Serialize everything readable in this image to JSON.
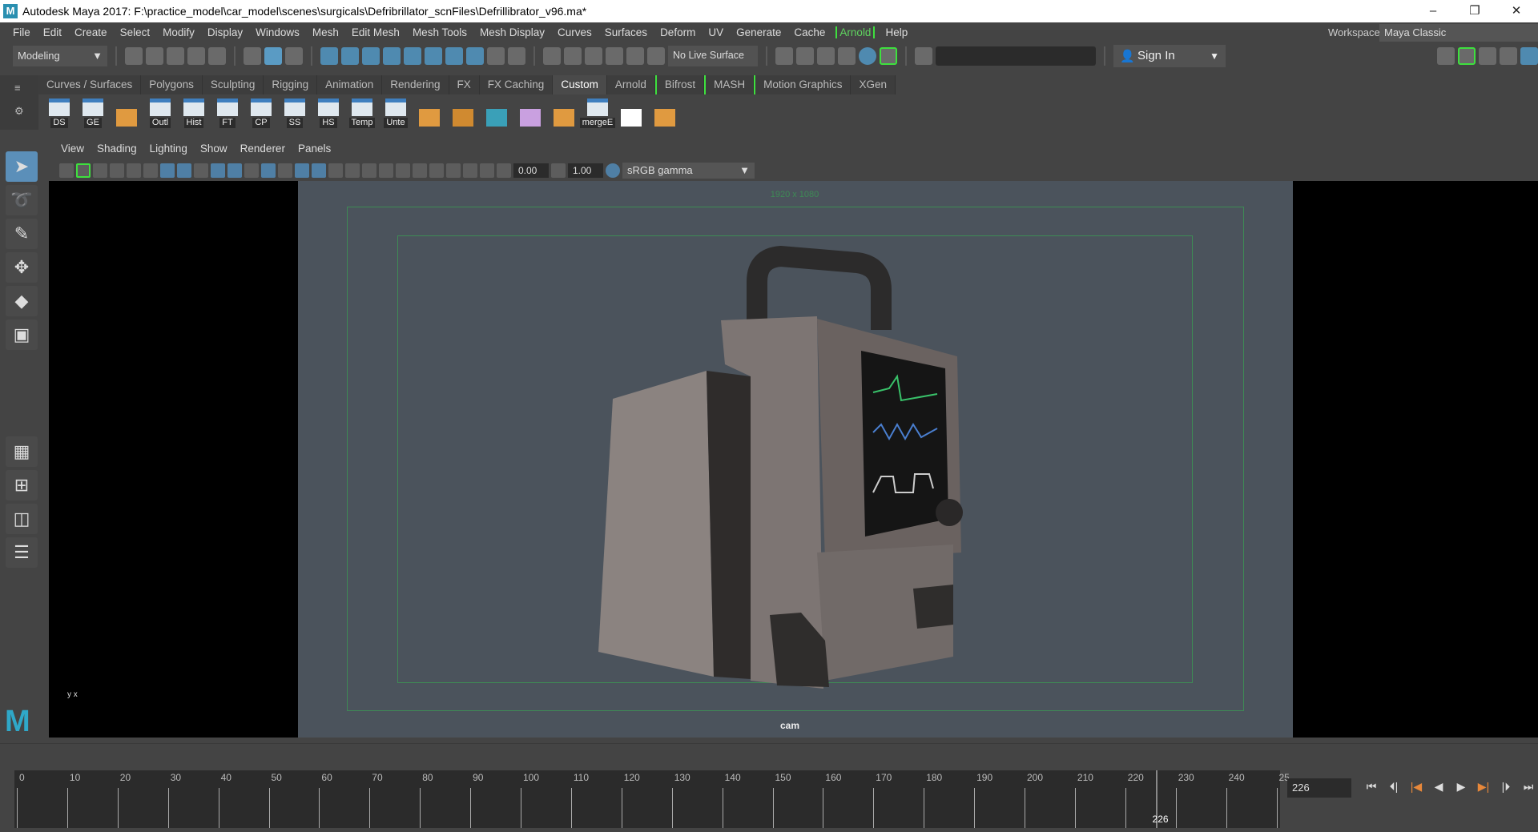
{
  "window": {
    "title": "Autodesk Maya 2017: F:\\practice_model\\car_model\\scenes\\surgicals\\Defribrillator_scnFiles\\Defrillibrator_v96.ma*",
    "logo": "M",
    "minimize": "–",
    "restore": "❐",
    "close": "✕"
  },
  "menubar": {
    "items": [
      "File",
      "Edit",
      "Create",
      "Select",
      "Modify",
      "Display",
      "Windows",
      "Mesh",
      "Edit Mesh",
      "Mesh Tools",
      "Mesh Display",
      "Curves",
      "Surfaces",
      "Deform",
      "UV",
      "Generate",
      "Cache",
      "Arnold",
      "Help"
    ]
  },
  "workspace": {
    "label": "Workspace :",
    "value": "Maya Classic"
  },
  "statusline": {
    "mode": "Modeling",
    "live_surface": "No Live Surface",
    "sign_in": "Sign In"
  },
  "shelf": {
    "tabs": [
      "Curves / Surfaces",
      "Polygons",
      "Sculpting",
      "Rigging",
      "Animation",
      "Rendering",
      "FX",
      "FX Caching",
      "Custom",
      "Arnold",
      "Bifrost",
      "MASH",
      "Motion Graphics",
      "XGen"
    ],
    "active_tab": "Custom",
    "buttons": [
      "DS",
      "GE",
      "",
      "Outl",
      "Hist",
      "FT",
      "CP",
      "SS",
      "HS",
      "Temp",
      "Unte",
      "",
      "",
      "",
      "",
      "",
      "mergeE",
      "",
      ""
    ]
  },
  "panel": {
    "menus": [
      "View",
      "Shading",
      "Lighting",
      "Show",
      "Renderer",
      "Panels"
    ],
    "exposure": "0.00",
    "gamma": "1.00",
    "color_space": "sRGB gamma",
    "resolution": "1920 x 1080",
    "camera": "cam",
    "axis": "y  x"
  },
  "timeline": {
    "ticks": [
      0,
      10,
      20,
      30,
      40,
      50,
      60,
      70,
      80,
      90,
      100,
      110,
      120,
      130,
      140,
      150,
      160,
      170,
      180,
      190,
      200,
      210,
      220,
      230,
      240,
      25
    ],
    "current_frame": "226",
    "current_frame_value": 226,
    "buttons": [
      "⏮",
      "⏴|",
      "|◀",
      "◀",
      "▶",
      "▶|",
      "|⏵",
      "⏭"
    ]
  },
  "colors": {
    "accent": "#5b8fb9",
    "arnold_green": "#3ee03e",
    "gate": "#3e8a55",
    "viewport_bg": "#4b535c"
  }
}
